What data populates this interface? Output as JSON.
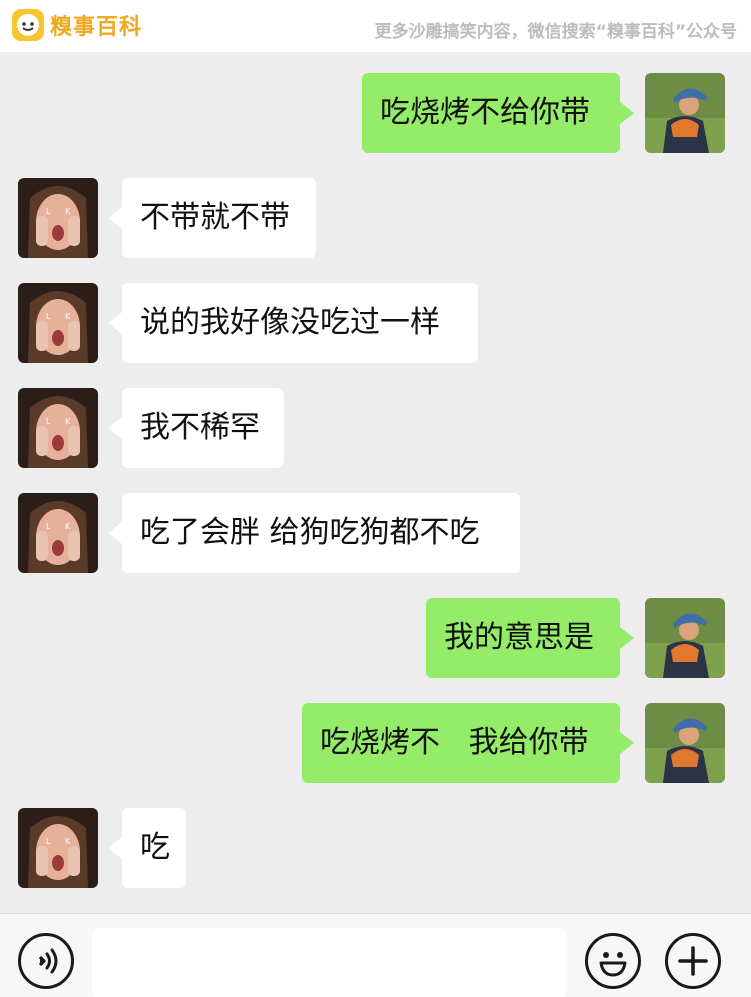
{
  "header": {
    "logo_text": "糗事百科",
    "watermark": "更多沙雕搞笑内容，微信搜索“糗事百科”公众号"
  },
  "messages": [
    {
      "side": "right",
      "text": "吃烧烤不给你带"
    },
    {
      "side": "left",
      "text": "不带就不带"
    },
    {
      "side": "left",
      "text": "说的我好像没吃过一样"
    },
    {
      "side": "left",
      "text": "我不稀罕"
    },
    {
      "side": "left",
      "text": "吃了会胖 给狗吃狗都不吃"
    },
    {
      "side": "right",
      "text": "我的意思是"
    },
    {
      "side": "right",
      "text": "吃烧烤不   我给你带"
    },
    {
      "side": "left",
      "text": "吃"
    }
  ],
  "input_bar": {
    "voice_icon": "voice-icon",
    "emoji_icon": "emoji-icon",
    "plus_icon": "plus-icon",
    "text_value": ""
  },
  "colors": {
    "background": "#ededed",
    "self_bubble": "#95ec69",
    "other_bubble": "#ffffff",
    "logo": "#f7c531"
  }
}
